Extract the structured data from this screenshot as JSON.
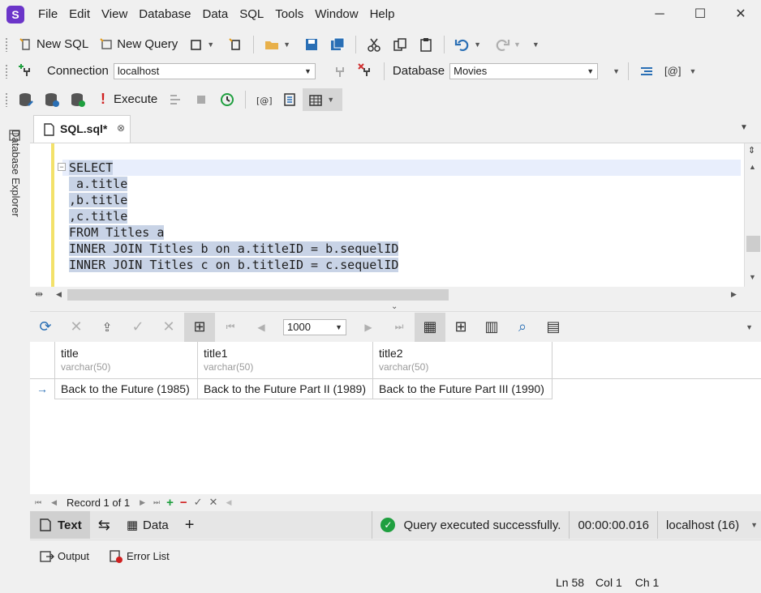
{
  "menu": [
    "File",
    "Edit",
    "View",
    "Database",
    "Data",
    "SQL",
    "Tools",
    "Window",
    "Help"
  ],
  "app_logo": "S",
  "window_controls": {
    "minimize": "─",
    "maximize": "☐",
    "close": "✕"
  },
  "toolbar1": {
    "new_sql": "New SQL",
    "new_query": "New Query"
  },
  "toolbar2": {
    "connection_label": "Connection",
    "connection_value": "localhost",
    "database_label": "Database",
    "database_value": "Movies",
    "at_label": "[@]"
  },
  "toolbar3": {
    "execute_label": "Execute",
    "execute_mark": "!"
  },
  "side_panel": {
    "label": "Database Explorer"
  },
  "doc_tab": {
    "label": "SQL.sql*"
  },
  "editor": {
    "lines": [
      "SELECT",
      " a.title",
      ",b.title",
      ",c.title",
      "FROM Titles a",
      "INNER JOIN Titles b on a.titleID = b.sequelID",
      "INNER JOIN Titles c on b.titleID = c.sequelID"
    ]
  },
  "grid_toolbar": {
    "page_size": "1000"
  },
  "grid": {
    "columns": [
      {
        "name": "title",
        "type": "varchar(50)"
      },
      {
        "name": "title1",
        "type": "varchar(50)"
      },
      {
        "name": "title2",
        "type": "varchar(50)"
      }
    ],
    "rows": [
      [
        "Back to the Future (1985)",
        "Back to the Future Part II (1989)",
        "Back to the Future Part III (1990)"
      ]
    ],
    "row_indicator": "→"
  },
  "navigator": {
    "record_text": "Record 1 of 1"
  },
  "status": {
    "text_tab": "Text",
    "data_tab": "Data",
    "add_tab": "+",
    "message": "Query executed successfully.",
    "elapsed": "00:00:00.016",
    "server": "localhost (16)"
  },
  "output_tabs": {
    "output": "Output",
    "error_list": "Error List"
  },
  "cursor": {
    "line": "Ln 58",
    "col": "Col 1",
    "ch": "Ch 1"
  },
  "colors": {
    "accent": "#2a6fb5",
    "logo": "#6b35c9",
    "success": "#1f9f3f",
    "selection": "#c8d3e6"
  }
}
